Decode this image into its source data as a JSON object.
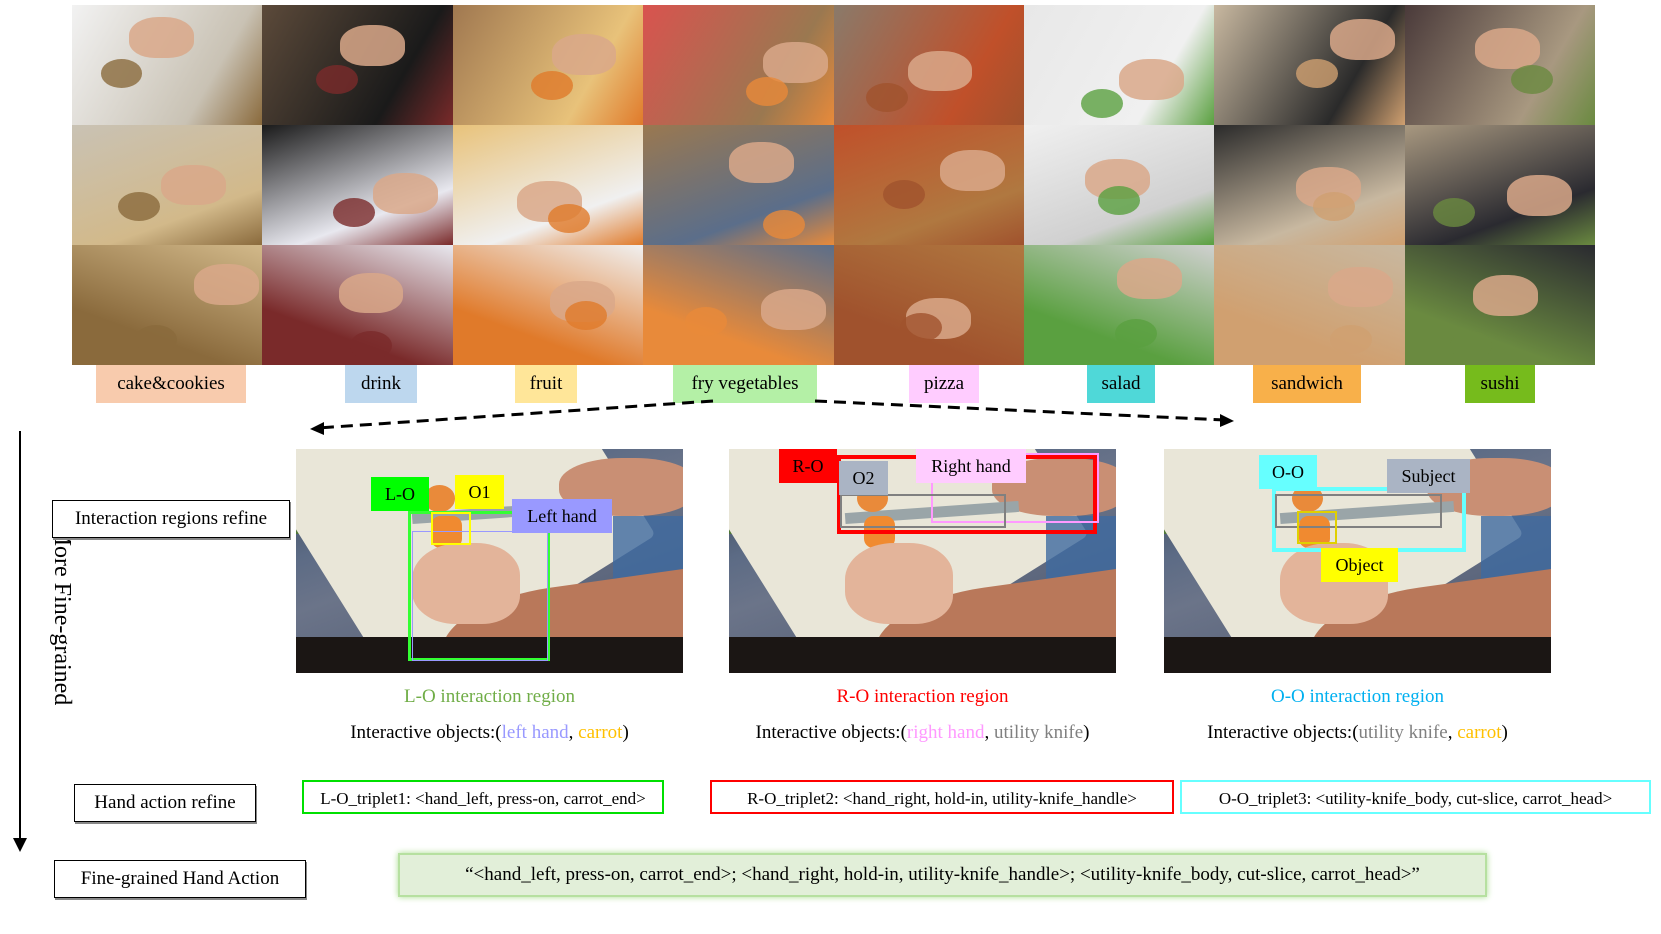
{
  "categories": [
    {
      "label": "cake&cookies",
      "color": "#f8cbad"
    },
    {
      "label": "drink",
      "color": "#bdd7ee"
    },
    {
      "label": "fruit",
      "color": "#ffe699"
    },
    {
      "label": "fry vegetables",
      "color": "#b4f0a6"
    },
    {
      "label": "pizza",
      "color": "#ffccff"
    },
    {
      "label": "salad",
      "color": "#4fd8d8"
    },
    {
      "label": "sandwich",
      "color": "#f8b04a"
    },
    {
      "label": "sushi",
      "color": "#76bb1c"
    }
  ],
  "axis": {
    "label": "More Fine-grained"
  },
  "stages": {
    "regions": "Interaction regions refine",
    "action": "Hand action refine",
    "final": "Fine-grained Hand Action"
  },
  "panels": [
    {
      "id": "lo",
      "tags": {
        "main": "L-O",
        "object": "O1",
        "subject": "Left hand"
      },
      "caption": "L-O interaction region",
      "caption_color": "#70ad47",
      "objects_prefix": "Interactive objects:(",
      "objects": [
        {
          "text": "left hand",
          "color": "#9999ff"
        },
        {
          "text": ", ",
          "color": "#000000"
        },
        {
          "text": "carrot",
          "color": "#ffc000"
        }
      ],
      "objects_suffix": ")"
    },
    {
      "id": "ro",
      "tags": {
        "main": "R-O",
        "object": "O2",
        "subject": "Right hand"
      },
      "caption": "R-O interaction region",
      "caption_color": "#ff0000",
      "objects_prefix": "Interactive objects:(",
      "objects": [
        {
          "text": "right hand",
          "color": "#ff99ff"
        },
        {
          "text": ", ",
          "color": "#000000"
        },
        {
          "text": "utility knife",
          "color": "#808080"
        }
      ],
      "objects_suffix": ")"
    },
    {
      "id": "oo",
      "tags": {
        "main": "O-O",
        "object": "Object",
        "subject": "Subject"
      },
      "caption": "O-O interaction region",
      "caption_color": "#00b0f0",
      "objects_prefix": "Interactive objects:(",
      "objects": [
        {
          "text": "utility knife",
          "color": "#808080"
        },
        {
          "text": ", ",
          "color": "#000000"
        },
        {
          "text": "carrot",
          "color": "#ffc000"
        }
      ],
      "objects_suffix": ")"
    }
  ],
  "triplets": [
    {
      "text": "L-O_triplet1: <hand_left, press-on, carrot_end>",
      "border": "#00e000"
    },
    {
      "text": "R-O_triplet2: <hand_right, hold-in, utility-knife_handle>",
      "border": "#ff0000"
    },
    {
      "text": "O-O_triplet3: <utility-knife_body, cut-slice, carrot_head>",
      "border": "#66ffff"
    }
  ],
  "final_action": "“<hand_left, press-on, carrot_end>; <hand_right, hold-in, utility-knife_handle>; <utility-knife_body, cut-slice, carrot_head>”",
  "colors": {
    "lo_box": "#33ff33",
    "lo_tag": "#00ff00",
    "o1_tag": "#ffff00",
    "lefthand_tag": "#9999ff",
    "ro_box": "#ff0000",
    "o2_tag": "#aab4c4",
    "righthand_tag": "#ffccff",
    "oo_box": "#66ffff",
    "subject_tag": "#aab4c4",
    "object_tag": "#ffff00"
  }
}
